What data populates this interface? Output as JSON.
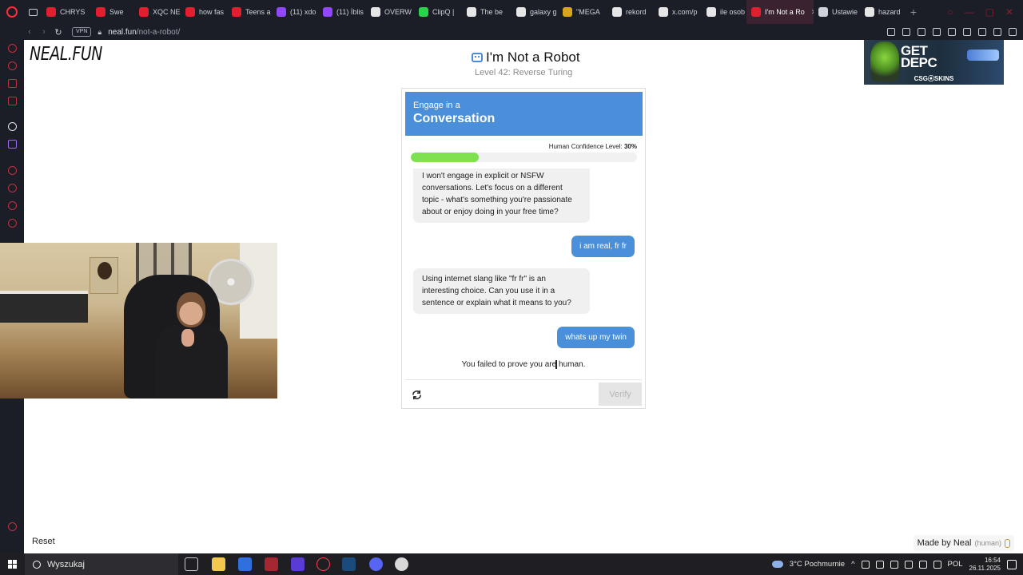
{
  "browser": {
    "tabs": [
      {
        "label": "CHRYS",
        "color": "#e0202e"
      },
      {
        "label": "Swe",
        "color": "#e0202e"
      },
      {
        "label": "XQC NE",
        "color": "#e0202e"
      },
      {
        "label": "how fas",
        "color": "#e0202e"
      },
      {
        "label": "Teens a",
        "color": "#e0202e"
      },
      {
        "label": "(11) xdo",
        "color": "#9146ff"
      },
      {
        "label": "(11) İblis",
        "color": "#9146ff"
      },
      {
        "label": "OVERW",
        "color": "#e6e6e6"
      },
      {
        "label": "ClipQ |",
        "color": "#2dd24b"
      },
      {
        "label": "The be",
        "color": "#e6e6e6"
      },
      {
        "label": "galaxy g",
        "color": "#e6e6e6"
      },
      {
        "label": "\"MEGA",
        "color": "#d9a520"
      },
      {
        "label": "rekord",
        "color": "#e6e6e6"
      },
      {
        "label": "x.com/p",
        "color": "#e6e6e6"
      },
      {
        "label": "ile osob",
        "color": "#e6e6e6"
      },
      {
        "label": "I'm Not a Ro",
        "color": "#e0202e",
        "active": true
      },
      {
        "label": "Ustawie",
        "color": "#cfd2da"
      },
      {
        "label": "hazard",
        "color": "#e6e6e6"
      }
    ],
    "url_host": "neal.fun",
    "url_path": "/not-a-robot/",
    "vpn_label": "VPN"
  },
  "page": {
    "logo": "NEAL.FUN",
    "title": "I'm Not a Robot",
    "subtitle": "Level 42: Reverse Turing",
    "ad": {
      "headline_line1": "GET",
      "headline_line2": "DEPC",
      "brand": "CSG⦿SKINS"
    },
    "widget": {
      "header_small": "Engage in a",
      "header_big": "Conversation",
      "confidence_label": "Human Confidence Level:",
      "confidence_value": "30%",
      "confidence_fraction": 0.3,
      "messages": [
        {
          "role": "bot",
          "text": "I won't engage in explicit or NSFW conversations. Let's focus on a different topic - what's something you're passionate about or enjoy doing in your free time?"
        },
        {
          "role": "user",
          "text": "i am real, fr fr"
        },
        {
          "role": "bot",
          "text": "Using internet slang like \"fr fr\" is an interesting choice. Can you use it in a sentence or explain what it means to you?"
        },
        {
          "role": "user",
          "text": "whats up my twin"
        }
      ],
      "result": "You failed to prove you are human.",
      "verify_label": "Verify",
      "refresh_icon": "refresh-icon"
    },
    "reset_label": "Reset",
    "made_by": "Made by Neal",
    "made_by_tag": "(human)"
  },
  "taskbar": {
    "search_placeholder": "Wyszukaj",
    "weather": "3°C  Pochmurnie",
    "language": "POL",
    "time": "16:54",
    "date": "26.11.2025"
  }
}
